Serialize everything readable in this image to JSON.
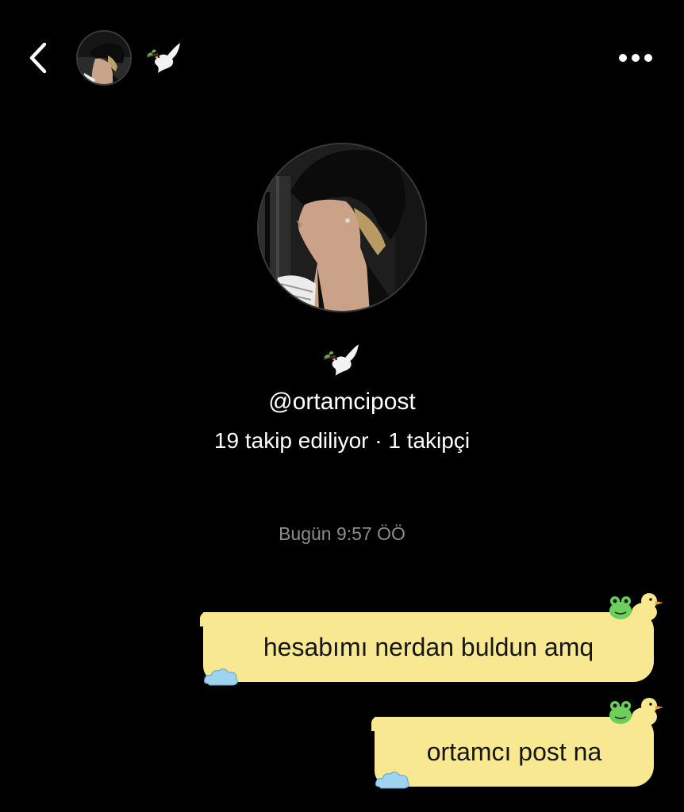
{
  "header": {
    "back_icon": "chevron-left-icon",
    "title_emoji": "🕊️",
    "more_icon": "more-horizontal-icon"
  },
  "profile": {
    "emoji": "🕊️",
    "username": "@ortamcipost",
    "stats": "19 takip ediliyor · 1 takipçi"
  },
  "conversation": {
    "timestamp": "Bugün 9:57 ÖÖ",
    "messages": [
      {
        "text": "hesabımı nerdan buldun amq",
        "sender": "me"
      },
      {
        "text": "ortamcı post na",
        "sender": "me"
      }
    ]
  },
  "colors": {
    "background": "#000000",
    "bubble": "#f8e891",
    "bubble_text": "#161616",
    "timestamp": "#8c8c8c",
    "frog": "#6ccf5b",
    "duck": "#f8e891",
    "cloud": "#9fd3f0"
  }
}
